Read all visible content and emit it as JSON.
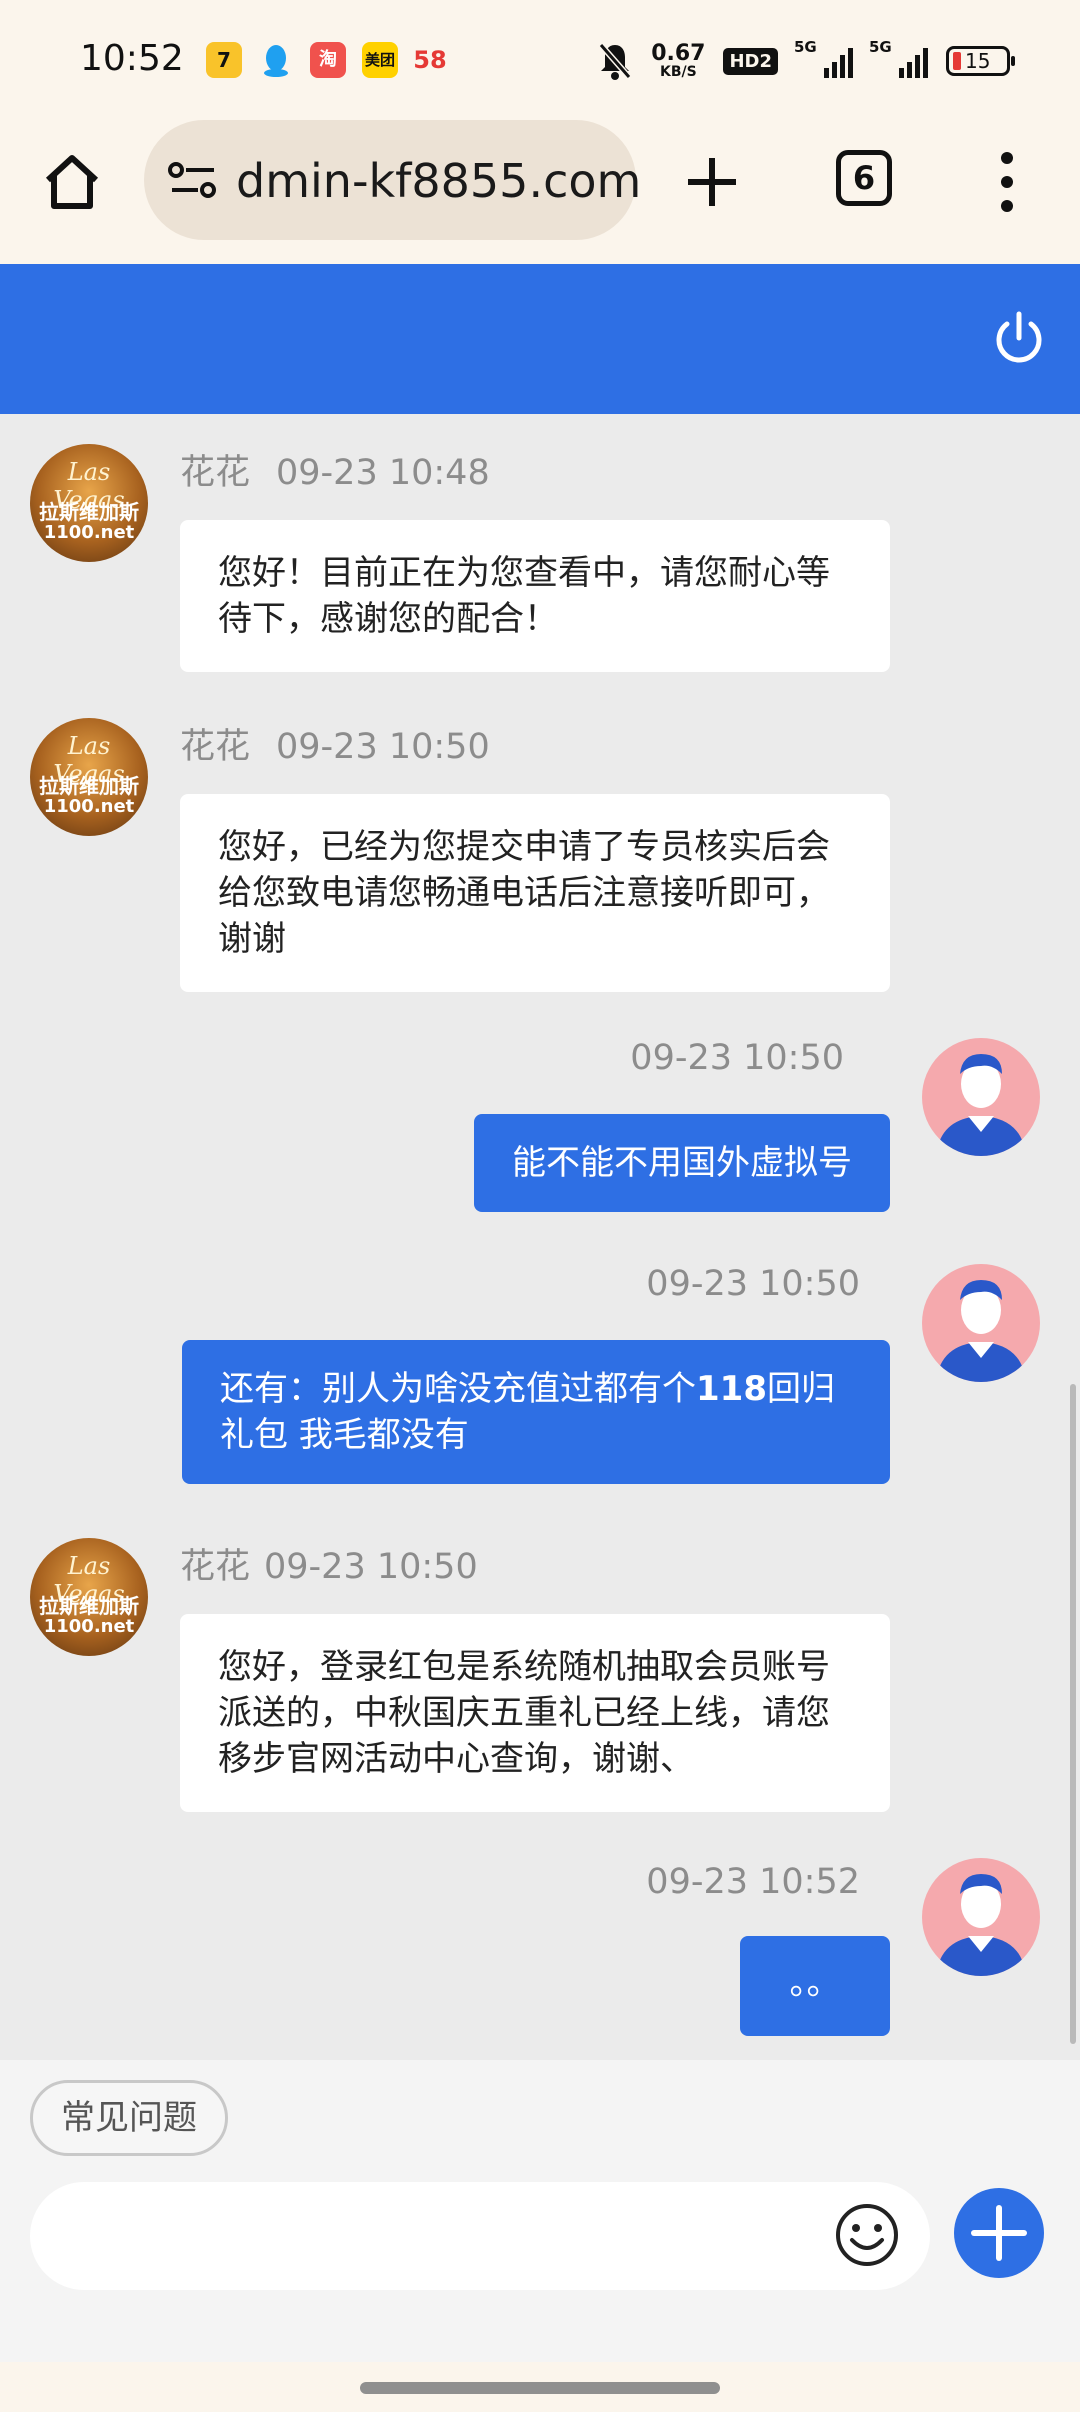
{
  "status_bar": {
    "time": "10:52",
    "apps": [
      {
        "icon": "tencent-video-icon",
        "glyph": "7",
        "color": "#f9c32a"
      },
      {
        "icon": "qq-icon",
        "glyph": "",
        "color": "#1fa0f0"
      },
      {
        "icon": "taobao-icon",
        "glyph": "淘",
        "color": "#f0524d"
      },
      {
        "icon": "meituan-icon",
        "glyph": "美团",
        "color": "#ffd100"
      },
      {
        "icon": "58-icon",
        "glyph": "58",
        "color": "#fbf5ec"
      }
    ],
    "net_speed_value": "0.67",
    "net_speed_unit": "KB/S",
    "hd_label": "HD2",
    "sim1_label": "5G",
    "sim2_label": "5G",
    "battery_level": "15"
  },
  "browser": {
    "url": "dmin-kf8855.com",
    "tab_count": "6",
    "icons": {
      "home": "home-icon",
      "site": "site-settings-icon",
      "new_tab": "plus-icon",
      "menu": "more-vert-icon"
    }
  },
  "header": {
    "color": "#2e6fe4",
    "icon": "power-icon"
  },
  "agent_avatar": {
    "line1": "Las Vegas",
    "line2": "拉斯维加斯",
    "line3": "1100.net"
  },
  "messages": [
    {
      "side": "in",
      "name": "花花",
      "time": "09-23 10:48",
      "text": "您好！目前正在为您查看中，请您耐心等待下，感谢您的配合！"
    },
    {
      "side": "in",
      "name": "花花",
      "time": "09-23 10:50",
      "text": "您好，已经为您提交申请了专员核实后会给您致电请您畅通电话后注意接听即可，谢谢"
    },
    {
      "side": "out",
      "time": "09-23 10:50",
      "text": "能不能不用国外虚拟号"
    },
    {
      "side": "out",
      "time": "09-23 10:50",
      "text_before": "还有：别人为啥没充值过都有个",
      "text_bold": "118",
      "text_after": "回归礼包 我毛都没有"
    },
    {
      "side": "in",
      "name": "花花",
      "time": "09-23 10:50",
      "text": "您好，登录红包是系统随机抽取会员账号派送的，中秋国庆五重礼已经上线，请您移步官网活动中心查询，谢谢、"
    },
    {
      "side": "out",
      "time": "09-23 10:52",
      "text": "。。"
    }
  ],
  "composer": {
    "faq_label": "常见问题",
    "input_placeholder": "",
    "emoji_icon": "emoji-icon",
    "add_icon": "plus-circle-icon"
  }
}
